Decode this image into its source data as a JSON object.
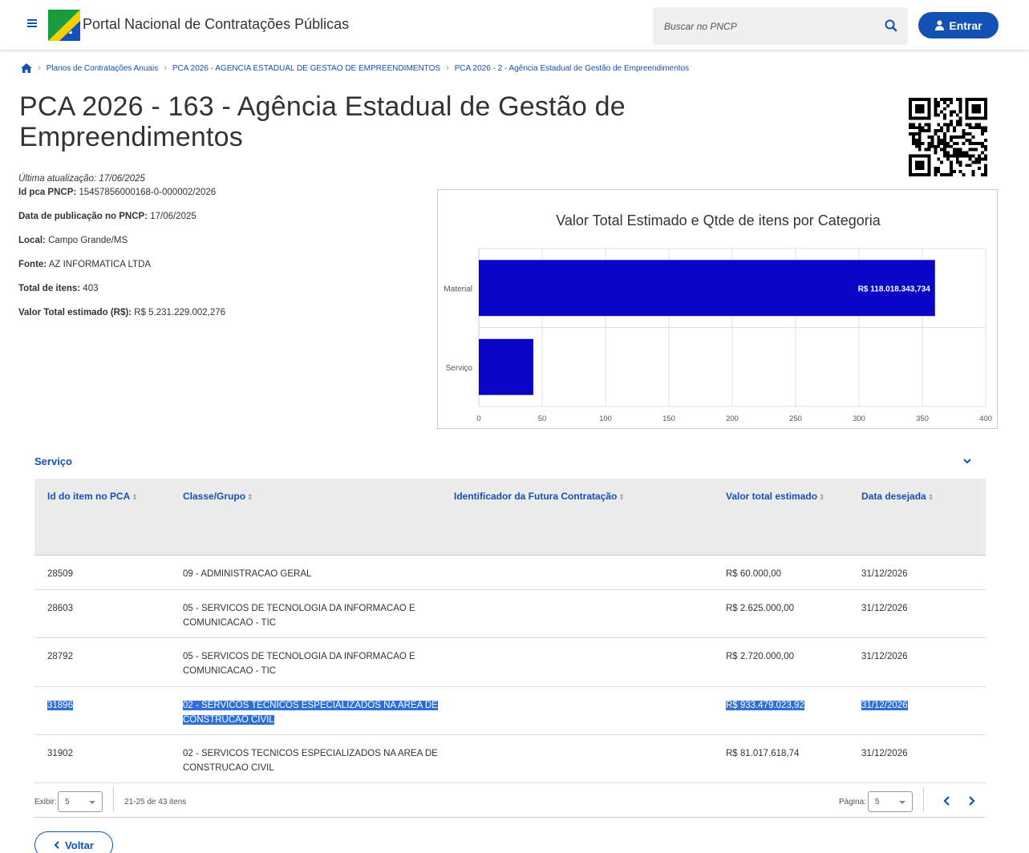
{
  "header": {
    "site_title": "Portal Nacional de Contratações Públicas",
    "search_placeholder": "Buscar no PNCP",
    "login_label": "Entrar"
  },
  "breadcrumb": [
    "Planos de Contratações Anuais",
    "PCA 2026 - AGENCIA ESTADUAL DE GESTAO DE EMPREENDIMENTOS",
    "PCA 2026 - 2 - Agência Estadual de Gestão de Empreendimentos"
  ],
  "page": {
    "title": "PCA 2026 - 163 - Agência Estadual de Gestão de Empreendimentos",
    "updated": "Última atualização: 17/06/2025",
    "fields": [
      {
        "label": "Id pca PNCP:",
        "value": " 15457856000168-0-000002/2026"
      },
      {
        "label": "Data de publicação no PNCP:",
        "value": " 17/06/2025"
      },
      {
        "label": "Local:",
        "value": " Campo Grande/MS"
      },
      {
        "label": "Fonte:",
        "value": " AZ INFORMATICA LTDA"
      },
      {
        "label": "Total de itens:",
        "value": " 403"
      },
      {
        "label": "Valor Total estimado (R$):",
        "value": " R$ 5.231.229.002,276"
      }
    ]
  },
  "chart_data": {
    "type": "bar",
    "orientation": "horizontal",
    "title": "Valor Total Estimado e Qtde de itens por Categoria",
    "categories": [
      "Material",
      "Serviço"
    ],
    "values": [
      360,
      43
    ],
    "data_labels": [
      "R$ 118.018.343,734",
      ""
    ],
    "xlim": [
      0,
      400
    ],
    "xticks": [
      "0",
      "50",
      "100",
      "150",
      "200",
      "250",
      "300",
      "350",
      "400"
    ],
    "grid": true,
    "bar_color": "#0a06c8"
  },
  "section": {
    "title": "Serviço",
    "columns": [
      "Id do item no PCA",
      "Classe/Grupo",
      "Identificador da Futura Contratação",
      "Valor total estimado",
      "Data desejada"
    ],
    "rows": [
      {
        "id": "28509",
        "classe": "09 - ADMINISTRACAO GERAL",
        "ident": "",
        "valor": "R$ 60.000,00",
        "data": "31/12/2026"
      },
      {
        "id": "28603",
        "classe": "05 - SERVICOS DE TECNOLOGIA DA INFORMACAO E COMUNICACAO - TIC",
        "ident": "",
        "valor": "R$ 2.625.000,00",
        "data": "31/12/2026"
      },
      {
        "id": "28792",
        "classe": "05 - SERVICOS DE TECNOLOGIA DA INFORMACAO E COMUNICACAO - TIC",
        "ident": "",
        "valor": "R$ 2.720.000,00",
        "data": "31/12/2026"
      },
      {
        "id": "31896",
        "classe": "02 - SERVICOS TECNICOS ESPECIALIZADOS NA AREA DE CONSTRUCAO CIVIL",
        "ident": "",
        "valor": "R$ 933.479.023,92",
        "data": "31/12/2026"
      },
      {
        "id": "31902",
        "classe": "02 - SERVICOS TECNICOS ESPECIALIZADOS NA AREA DE CONSTRUCAO CIVIL",
        "ident": "",
        "valor": "R$ 81.017.618,74",
        "data": "31/12/2026"
      }
    ],
    "selected_row_index": 3
  },
  "pager": {
    "show_label": "Exibir:",
    "page_size": "5",
    "range_text": "21-25 de 43 itens",
    "page_label": "Página:",
    "page": "5"
  },
  "back_label": "Voltar",
  "colors": {
    "primary": "#1351b4",
    "highlight": "#2e6fd8"
  }
}
